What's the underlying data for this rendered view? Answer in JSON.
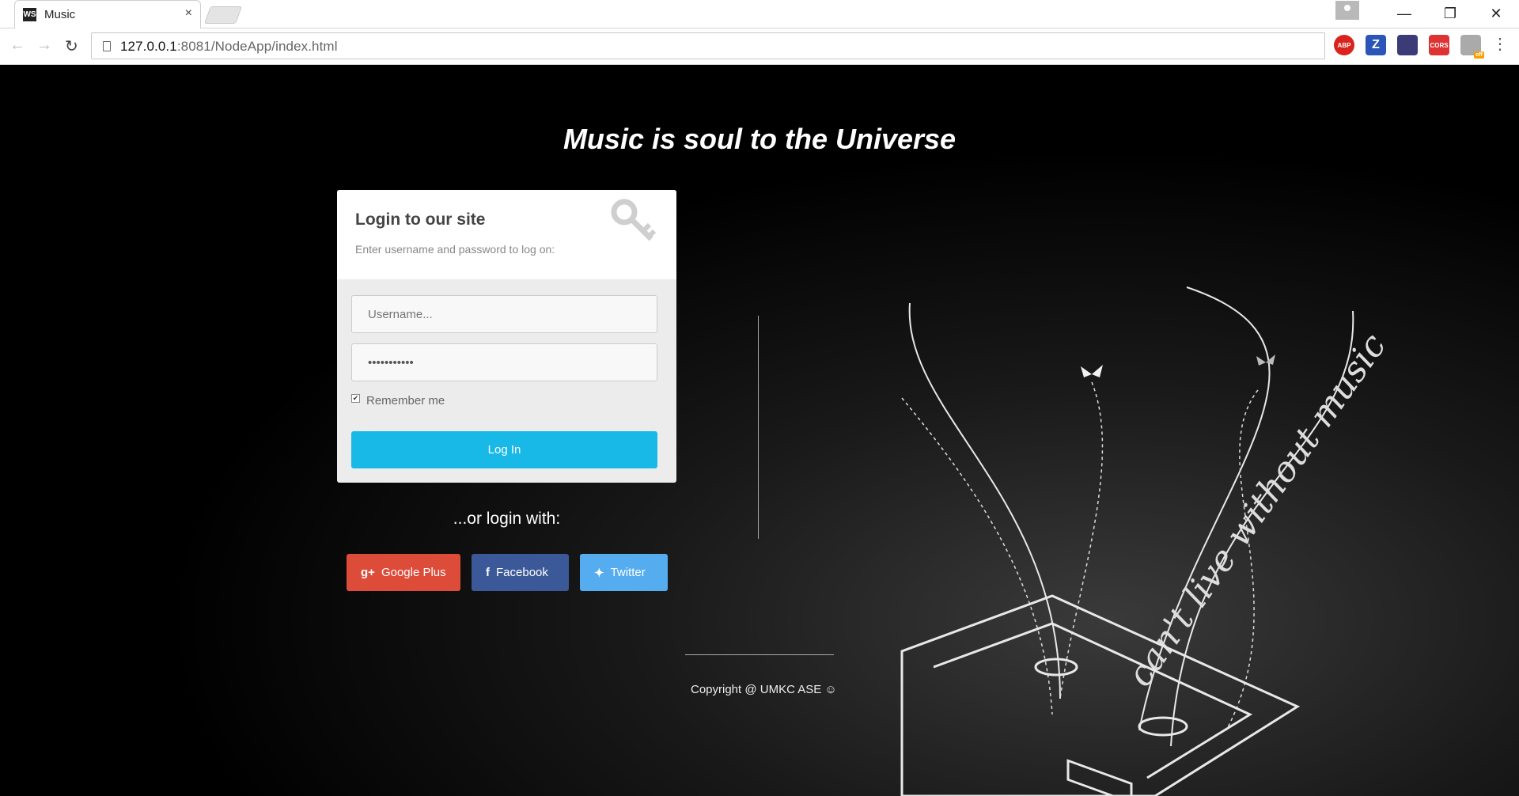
{
  "browser": {
    "tab_title": "Music",
    "tab_close": "×",
    "favicon_text": "WS",
    "url_host": "127.0.0.1",
    "url_rest": ":8081/NodeApp/index.html",
    "extensions": [
      "ABP",
      "Z",
      "",
      "CORS",
      ""
    ],
    "ext_badge": "off",
    "window_minimize": "—",
    "window_restore": "❐",
    "window_close": "✕"
  },
  "page": {
    "headline": "Music is soul to the Universe",
    "login": {
      "title": "Login to our site",
      "subtitle": "Enter username and password to log on:",
      "username_placeholder": "Username...",
      "password_value": "•••••••••••",
      "remember_label": "Remember me",
      "remember_checked": true,
      "submit_label": "Log In"
    },
    "or_login": "...or login with:",
    "social": {
      "google_label": "Google Plus",
      "facebook_label": "Facebook",
      "twitter_label": "Twitter"
    },
    "copyright": "Copyright @ UMKC ASE ☺",
    "art_text": "can't live without music"
  },
  "colors": {
    "login_button": "#19b9e7",
    "google": "#dd4b39",
    "facebook": "#3b5998",
    "twitter": "#55acee"
  }
}
